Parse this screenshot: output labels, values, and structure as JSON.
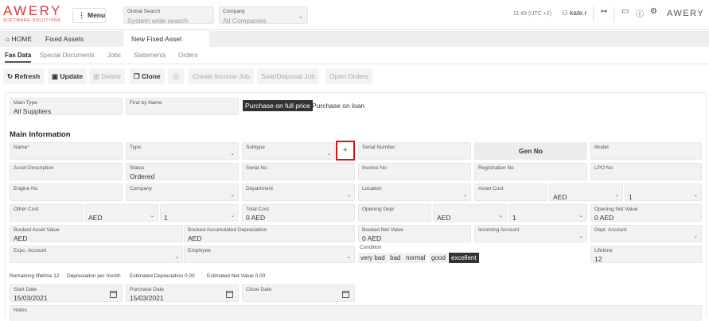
{
  "header": {
    "logo_text": "AWERY",
    "logo_subtitle": "SOFTWARE SOLUTIONS",
    "menu_label": "Menu",
    "global_search": {
      "label": "Global Search",
      "placeholder": "System wide search"
    },
    "company_select": {
      "label": "Company",
      "value": "All Companies"
    },
    "clock": "11:49 (UTC +2)",
    "username": "kate.r",
    "right_logo": "AWERY",
    "colors": {
      "brand": "#d93a3a"
    }
  },
  "tabs": [
    {
      "label": "HOME",
      "icon": "home-icon"
    },
    {
      "label": "Fixed Assets"
    },
    {
      "label": "New Fixed Asset",
      "active": true
    }
  ],
  "subtabs": [
    {
      "label": "Fas Data",
      "active": true
    },
    {
      "label": "Special Documents"
    },
    {
      "label": "Jobs"
    },
    {
      "label": "Statements"
    },
    {
      "label": "Orders"
    }
  ],
  "toolbar": {
    "refresh": "Refresh",
    "update": "Update",
    "delete": "Delete",
    "clone": "Clone",
    "create_income_job": "Create Income Job",
    "sale_disposal_job": "Sale/Disposal Job",
    "open_orders": "Open Orders"
  },
  "top_form": {
    "main_type": {
      "label": "Main Type",
      "value": "All Suppliers"
    },
    "find_by_name": {
      "label": "Find by Name",
      "value": ""
    },
    "purchase_full": "Purchase on full price",
    "purchase_loan": "Purchase on loan"
  },
  "main_info": {
    "title": "Main Information",
    "name": {
      "label": "Name",
      "required_mark": "*"
    },
    "type": {
      "label": "Type"
    },
    "subtype": {
      "label": "Subtype"
    },
    "add_symbol": "+",
    "serial_number": {
      "label": "Serial Number"
    },
    "gen_no": "Gen No",
    "model": {
      "label": "Model"
    },
    "asset_description": {
      "label": "Asset Description"
    },
    "status": {
      "label": "Status",
      "value": "Ordered"
    },
    "serial_no": {
      "label": "Serial No"
    },
    "invoice_no": {
      "label": "Invoice No"
    },
    "registration_no": {
      "label": "Registration No"
    },
    "lpo_no": {
      "label": "LPO No"
    },
    "engine_no": {
      "label": "Engine No"
    },
    "company": {
      "label": "Company"
    },
    "department": {
      "label": "Department"
    },
    "location": {
      "label": "Location"
    },
    "asset_cost": {
      "label": "Asset Cost",
      "currency": "AED",
      "rate": "1"
    },
    "other_cost": {
      "label": "Other Cost",
      "currency": "AED",
      "rate": "1"
    },
    "total_cost": {
      "label": "Total Cost",
      "value": "0 AED"
    },
    "opening_depr": {
      "label": "Opening Depr",
      "currency": "AED",
      "rate": "1"
    },
    "opening_net_value": {
      "label": "Opening Net Value",
      "value": "0 AED"
    },
    "booked_asset_value": {
      "label": "Booked Asset Value",
      "value": "AED"
    },
    "booked_accum_depr": {
      "label": "Booked Accumulated Depreciation",
      "value": "AED"
    },
    "booked_net_value": {
      "label": "Booked Net Value",
      "value": "0 AED"
    },
    "incoming_account": {
      "label": "Incoming Account"
    },
    "depr_account": {
      "label": "Depr. Account"
    },
    "expc_account": {
      "label": "Expc. Account"
    },
    "employee": {
      "label": "Employee"
    },
    "condition": {
      "label": "Condition",
      "options": [
        "very bad",
        "bad",
        "normal",
        "good",
        "excellent"
      ],
      "selected": "excellent"
    },
    "lifetime": {
      "label": "Lifetime",
      "value": "12"
    }
  },
  "summary": {
    "remaining_lifetime": "Remaining lifetime 12",
    "depr_per_month": "Depreciation per month",
    "estimated_depr": "Estimated Depreciation 0.00",
    "estimated_net_value": "Estimated Net Value 0.00"
  },
  "dates": {
    "start_date": {
      "label": "Start Date",
      "value": "15/03/2021"
    },
    "purchase_date": {
      "label": "Purchase Date",
      "value": "15/03/2021"
    },
    "close_date": {
      "label": "Close Date",
      "value": ""
    }
  },
  "notes": {
    "label": "Notes"
  }
}
